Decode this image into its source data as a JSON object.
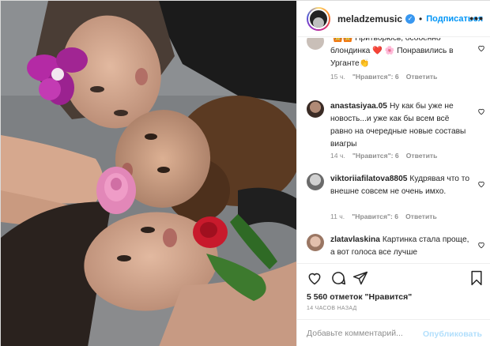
{
  "header": {
    "username": "meladzemusic",
    "follow_label": "Подписаться",
    "dot": "•",
    "more": "•••"
  },
  "comments": [
    {
      "username": "",
      "text": "🙆🙆 Притворюсь, особенно блондинка ❤️ 🌸 Понравились в Урганте👏",
      "time": "15 ч.",
      "likes": "\"Нравится\": 6",
      "reply": "Ответить"
    },
    {
      "username": "anastasiyaa.05",
      "text": "Ну как бы уже не новость...и уже как бы всем всё равно на очередные новые составы виагры",
      "time": "14 ч.",
      "likes": "\"Нравится\": 6",
      "reply": "Ответить"
    },
    {
      "username": "viktoriiafilatova8805",
      "text": "Кудрявая что то внешне совсем не очень имхо.",
      "time": "11 ч.",
      "likes": "\"Нравится\": 6",
      "reply": "Ответить"
    },
    {
      "username": "zlatavlaskina",
      "text": "Картинка стала проще, а вот голоса все лучше",
      "time": "",
      "likes": "",
      "reply": ""
    }
  ],
  "actions": {
    "likes": "5 560 отметок \"Нравится\"",
    "time": "14 ЧАСОВ НАЗАД"
  },
  "add_comment": {
    "placeholder": "Добавьте комментарий...",
    "publish": "Опубликовать"
  },
  "colors": {
    "accent": "#0095f6",
    "muted": "#8e8e8e",
    "border": "#efefef",
    "publish_disabled": "#b2dffc"
  }
}
